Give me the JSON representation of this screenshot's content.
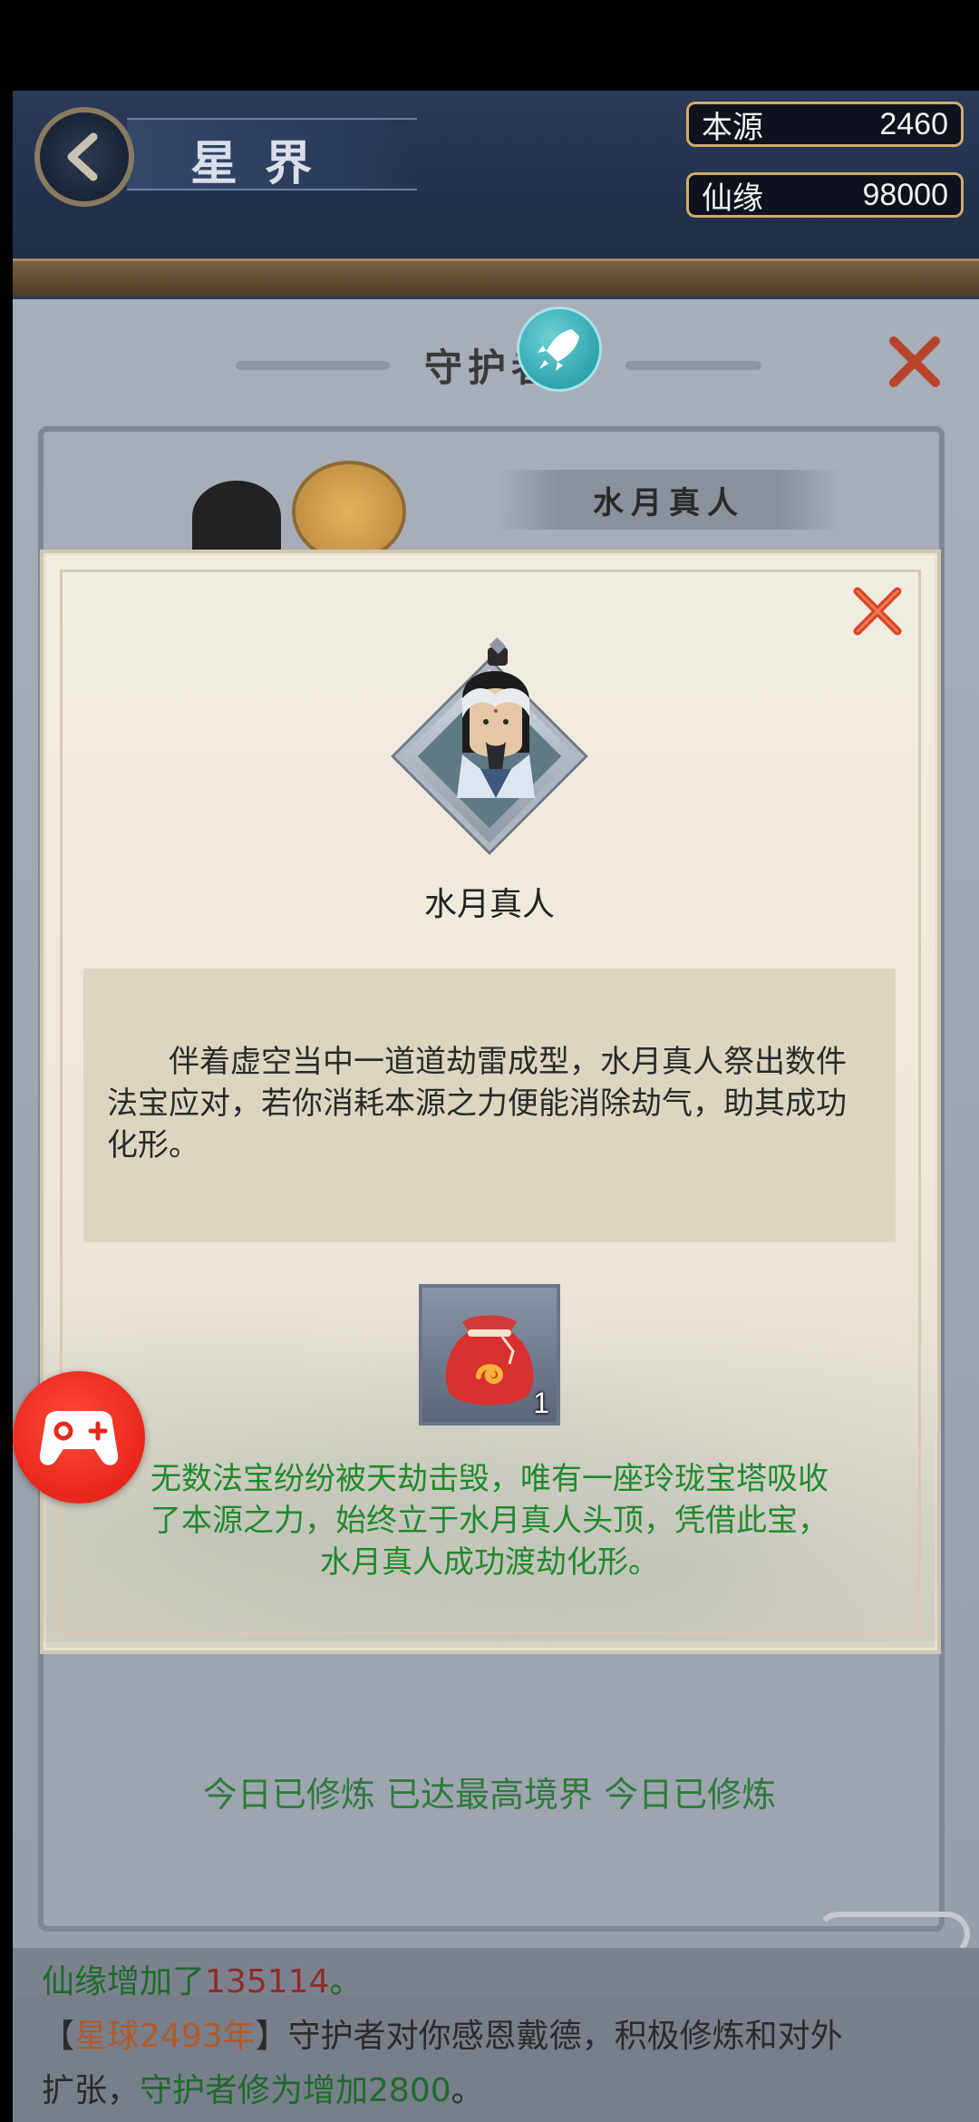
{
  "header": {
    "title": "星界",
    "resources": [
      {
        "label": "本源",
        "value": "2460"
      },
      {
        "label": "仙缘",
        "value": "98000"
      }
    ]
  },
  "background_panel": {
    "title": "守护者",
    "character_plaque": "水月真人"
  },
  "dialog": {
    "character_name": "水月真人",
    "description": "伴着虚空当中一道道劫雷成型，水月真人祭出数件法宝应对，若你消耗本源之力便能消除劫气，助其成功化形。",
    "item": {
      "icon": "red-pouch-icon",
      "count": "1"
    },
    "result": "无数法宝纷纷被天劫击毁，唯有一座玲珑宝塔吸收了本源之力，始终立于水月真人头顶，凭借此宝，水月真人成功渡劫化形。"
  },
  "status_line": "今日已修炼 已达最高境界 今日已修炼",
  "chat_log": {
    "line1": {
      "prefix": "仙缘增加了",
      "amount": "135114",
      "suffix": "。"
    },
    "line2": {
      "open": "【",
      "tag": "星球2493年",
      "close": "】",
      "text": "守护者对你感恩戴德，积极修炼和对外"
    },
    "line3": {
      "text": "扩张，",
      "highlight": "守护者修为增加2800",
      "suffix": "。"
    }
  },
  "colors": {
    "accent_green": "#1f8a2c",
    "close_red": "#d8432a",
    "fab_red": "#e8261a",
    "resource_border": "#d1ac6a"
  }
}
